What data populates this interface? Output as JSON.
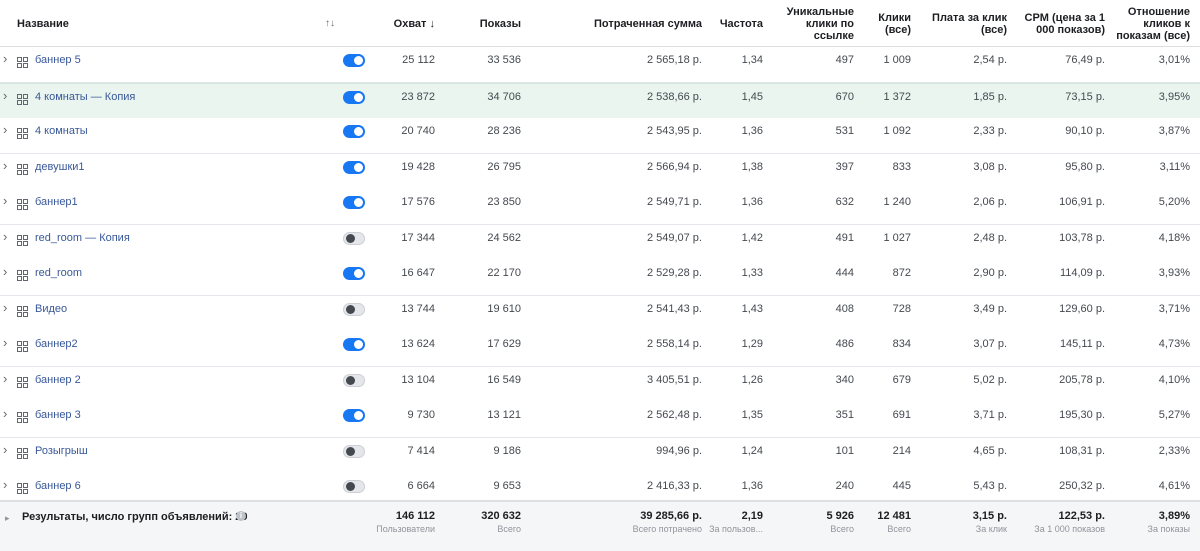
{
  "columns": {
    "name": "Название",
    "sort_icon": "↑↓",
    "reach": "Охват ↓",
    "impressions": "Показы",
    "spend": "Потраченная сумма",
    "frequency": "Частота",
    "unique_link_clicks": [
      "Уникальные",
      "клики по",
      "ссылке"
    ],
    "clicks_all": [
      "Клики",
      "(все)"
    ],
    "cpc_all": [
      "Плата за клик",
      "(все)"
    ],
    "cpm": [
      "CPM (цена за 1",
      "000 показов)"
    ],
    "ctr_all": [
      "Отношение",
      "кликов к",
      "показам (все)"
    ]
  },
  "rows": [
    {
      "name": "баннер 5",
      "active": true,
      "reach": "25 112",
      "impressions": "33 536",
      "spend": "2 565,18 р.",
      "frequency": "1,34",
      "unique_link_clicks": "497",
      "clicks_all": "1 009",
      "cpc_all": "2,54 р.",
      "cpm": "76,49 р.",
      "ctr_all": "3,01%"
    },
    {
      "name": "4 комнаты — Копия",
      "active": true,
      "selected": true,
      "reach": "23 872",
      "impressions": "34 706",
      "spend": "2 538,66 р.",
      "frequency": "1,45",
      "unique_link_clicks": "670",
      "clicks_all": "1 372",
      "cpc_all": "1,85 р.",
      "cpm": "73,15 р.",
      "ctr_all": "3,95%"
    },
    {
      "name": "4 комнаты",
      "active": true,
      "reach": "20 740",
      "impressions": "28 236",
      "spend": "2 543,95 р.",
      "frequency": "1,36",
      "unique_link_clicks": "531",
      "clicks_all": "1 092",
      "cpc_all": "2,33 р.",
      "cpm": "90,10 р.",
      "ctr_all": "3,87%"
    },
    {
      "name": "девушки1",
      "active": true,
      "reach": "19 428",
      "impressions": "26 795",
      "spend": "2 566,94 р.",
      "frequency": "1,38",
      "unique_link_clicks": "397",
      "clicks_all": "833",
      "cpc_all": "3,08 р.",
      "cpm": "95,80 р.",
      "ctr_all": "3,11%"
    },
    {
      "name": "баннер1",
      "active": true,
      "reach": "17 576",
      "impressions": "23 850",
      "spend": "2 549,71 р.",
      "frequency": "1,36",
      "unique_link_clicks": "632",
      "clicks_all": "1 240",
      "cpc_all": "2,06 р.",
      "cpm": "106,91 р.",
      "ctr_all": "5,20%"
    },
    {
      "name": "red_room — Копия",
      "active": false,
      "reach": "17 344",
      "impressions": "24 562",
      "spend": "2 549,07 р.",
      "frequency": "1,42",
      "unique_link_clicks": "491",
      "clicks_all": "1 027",
      "cpc_all": "2,48 р.",
      "cpm": "103,78 р.",
      "ctr_all": "4,18%"
    },
    {
      "name": "red_room",
      "active": true,
      "reach": "16 647",
      "impressions": "22 170",
      "spend": "2 529,28 р.",
      "frequency": "1,33",
      "unique_link_clicks": "444",
      "clicks_all": "872",
      "cpc_all": "2,90 р.",
      "cpm": "114,09 р.",
      "ctr_all": "3,93%"
    },
    {
      "name": "Видео",
      "active": false,
      "reach": "13 744",
      "impressions": "19 610",
      "spend": "2 541,43 р.",
      "frequency": "1,43",
      "unique_link_clicks": "408",
      "clicks_all": "728",
      "cpc_all": "3,49 р.",
      "cpm": "129,60 р.",
      "ctr_all": "3,71%"
    },
    {
      "name": "баннер2",
      "active": true,
      "reach": "13 624",
      "impressions": "17 629",
      "spend": "2 558,14 р.",
      "frequency": "1,29",
      "unique_link_clicks": "486",
      "clicks_all": "834",
      "cpc_all": "3,07 р.",
      "cpm": "145,11 р.",
      "ctr_all": "4,73%"
    },
    {
      "name": "баннер 2",
      "active": false,
      "reach": "13 104",
      "impressions": "16 549",
      "spend": "3 405,51 р.",
      "frequency": "1,26",
      "unique_link_clicks": "340",
      "clicks_all": "679",
      "cpc_all": "5,02 р.",
      "cpm": "205,78 р.",
      "ctr_all": "4,10%"
    },
    {
      "name": "баннер 3",
      "active": true,
      "reach": "9 730",
      "impressions": "13 121",
      "spend": "2 562,48 р.",
      "frequency": "1,35",
      "unique_link_clicks": "351",
      "clicks_all": "691",
      "cpc_all": "3,71 р.",
      "cpm": "195,30 р.",
      "ctr_all": "5,27%"
    },
    {
      "name": "Розыгрыш",
      "active": false,
      "reach": "7 414",
      "impressions": "9 186",
      "spend": "994,96 р.",
      "frequency": "1,24",
      "unique_link_clicks": "101",
      "clicks_all": "214",
      "cpc_all": "4,65 р.",
      "cpm": "108,31 р.",
      "ctr_all": "2,33%"
    },
    {
      "name": "баннер 6",
      "active": false,
      "reach": "6 664",
      "impressions": "9 653",
      "spend": "2 416,33 р.",
      "frequency": "1,36",
      "unique_link_clicks": "240",
      "clicks_all": "445",
      "cpc_all": "5,43 р.",
      "cpm": "250,32 р.",
      "ctr_all": "4,61%"
    }
  ],
  "footer": {
    "label": "Результаты, число групп объявлений: 29",
    "info_icon": "info-icon",
    "reach": {
      "value": "146 112",
      "sub": "Пользователи"
    },
    "impressions": {
      "value": "320 632",
      "sub": "Всего"
    },
    "spend": {
      "value": "39 285,66 р.",
      "sub": "Всего потрачено"
    },
    "frequency": {
      "value": "2,19",
      "sub": "За пользов..."
    },
    "unique_link_clicks": {
      "value": "5 926",
      "sub": "Всего"
    },
    "clicks_all": {
      "value": "12 481",
      "sub": "Всего"
    },
    "cpc_all": {
      "value": "3,15 р.",
      "sub": "За клик"
    },
    "cpm": {
      "value": "122,53 р.",
      "sub": "За 1 000 показов"
    },
    "ctr_all": {
      "value": "3,89%",
      "sub": "За показы"
    }
  },
  "colors": {
    "toggle_on": "#1877f2",
    "link": "#385898",
    "selected_row": "#eaf5ef"
  }
}
